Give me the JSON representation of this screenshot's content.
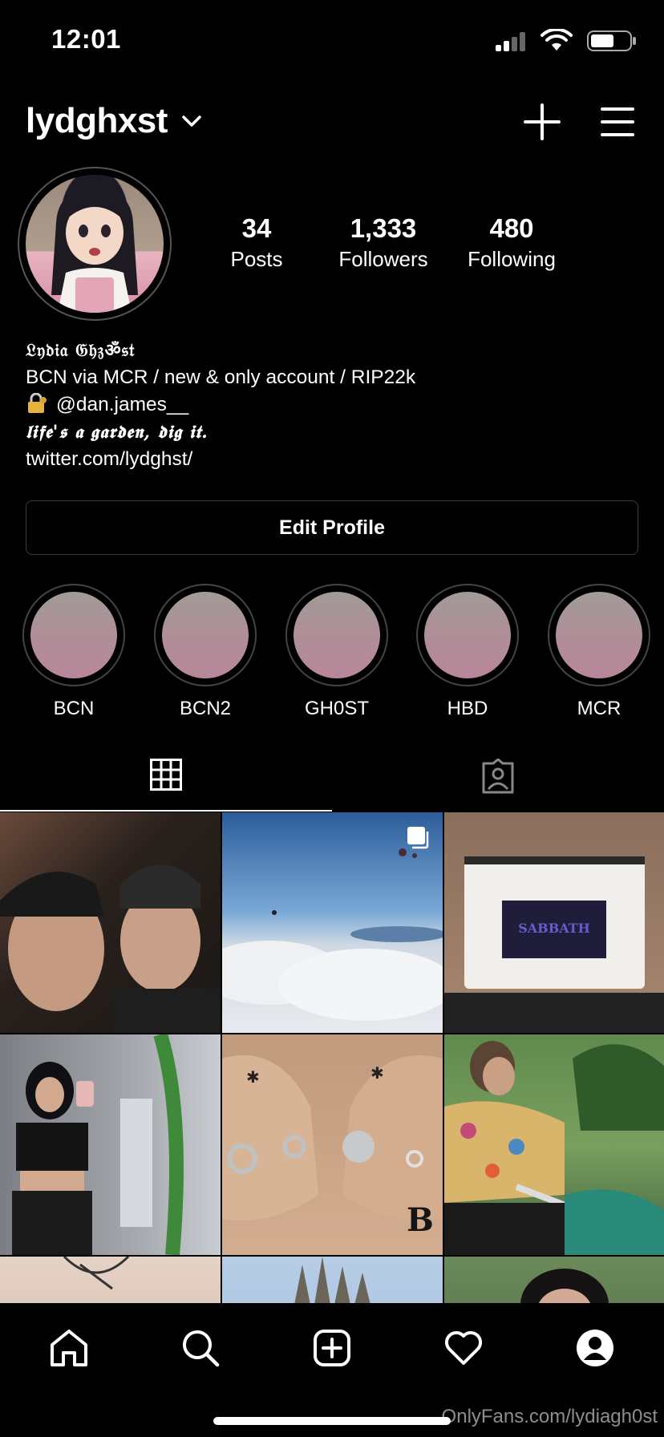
{
  "status_bar": {
    "time": "12:01"
  },
  "header": {
    "username": "lydghxst"
  },
  "profile": {
    "stats": [
      {
        "value": "34",
        "label": "Posts"
      },
      {
        "value": "1,333",
        "label": "Followers"
      },
      {
        "value": "480",
        "label": "Following"
      }
    ],
    "bio": {
      "name": "𝔏𝔶𝔡𝔦𝔞 𝔊𝔥𝔷ॐ𝔰𝔱",
      "line1": "BCN via MCR / new & only account / RIP22k",
      "line2_mention": "@dan.james__",
      "motto": "𝖑𝖎𝖋𝖊'𝖘 𝖆 𝖌𝖆𝖗𝖉𝖊𝖓, 𝖉𝖎𝖌 𝖎𝖙.",
      "link": "twitter.com/lydghst/"
    },
    "edit_button": "Edit Profile"
  },
  "highlights": [
    "BCN",
    "BCN2",
    "GH0ST",
    "HBD",
    "MCR"
  ],
  "tabs": {
    "grid_icon": "grid-icon",
    "tagged_icon": "tagged-icon"
  },
  "grid": {
    "photos": [
      {
        "description_icon": "photo",
        "multi": false
      },
      {
        "description_icon": "photo",
        "multi": true
      },
      {
        "description_icon": "photo",
        "multi": false
      },
      {
        "description_icon": "photo",
        "multi": false
      },
      {
        "description_icon": "photo",
        "multi": false
      },
      {
        "description_icon": "photo",
        "multi": false
      },
      {
        "description_icon": "photo",
        "multi": false
      },
      {
        "description_icon": "photo",
        "multi": false
      },
      {
        "description_icon": "photo",
        "multi": false
      }
    ]
  },
  "bottom_nav": [
    "home-icon",
    "search-icon",
    "create-icon",
    "heart-icon",
    "profile-icon"
  ],
  "watermark": "OnlyFans.com/lydiagh0st",
  "colors": {
    "background": "#000000",
    "text": "#ffffff",
    "border": "#3a3a3a",
    "highlight_fill": "#b08e98"
  }
}
